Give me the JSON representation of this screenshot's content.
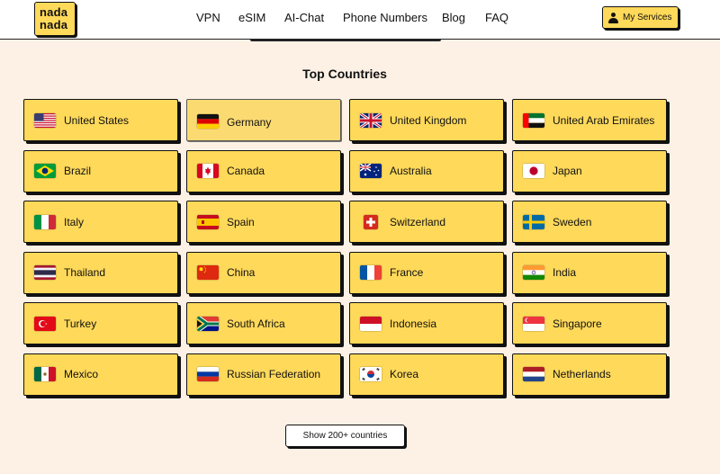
{
  "header": {
    "logo_line1": "nada",
    "logo_line2": "nada",
    "nav": [
      "VPN",
      "eSIM",
      "AI-Chat",
      "Phone Numbers",
      "Blog",
      "FAQ"
    ],
    "my_services": "My Services"
  },
  "section_title": "Top Countries",
  "countries": [
    {
      "name": "United States",
      "flag": "us-flag-icon"
    },
    {
      "name": "Germany",
      "flag": "de-flag-icon"
    },
    {
      "name": "United Kingdom",
      "flag": "gb-flag-icon"
    },
    {
      "name": "United Arab Emirates",
      "flag": "ae-flag-icon"
    },
    {
      "name": "Brazil",
      "flag": "br-flag-icon"
    },
    {
      "name": "Canada",
      "flag": "ca-flag-icon"
    },
    {
      "name": "Australia",
      "flag": "au-flag-icon"
    },
    {
      "name": "Japan",
      "flag": "jp-flag-icon"
    },
    {
      "name": "Italy",
      "flag": "it-flag-icon"
    },
    {
      "name": "Spain",
      "flag": "es-flag-icon"
    },
    {
      "name": "Switzerland",
      "flag": "ch-flag-icon"
    },
    {
      "name": "Sweden",
      "flag": "se-flag-icon"
    },
    {
      "name": "Thailand",
      "flag": "th-flag-icon"
    },
    {
      "name": "China",
      "flag": "cn-flag-icon"
    },
    {
      "name": "France",
      "flag": "fr-flag-icon"
    },
    {
      "name": "India",
      "flag": "in-flag-icon"
    },
    {
      "name": "Turkey",
      "flag": "tr-flag-icon"
    },
    {
      "name": "South Africa",
      "flag": "za-flag-icon"
    },
    {
      "name": "Indonesia",
      "flag": "id-flag-icon"
    },
    {
      "name": "Singapore",
      "flag": "sg-flag-icon"
    },
    {
      "name": "Mexico",
      "flag": "mx-flag-icon"
    },
    {
      "name": "Russian Federation",
      "flag": "ru-flag-icon"
    },
    {
      "name": "Korea",
      "flag": "kr-flag-icon"
    },
    {
      "name": "Netherlands",
      "flag": "nl-flag-icon"
    }
  ],
  "show_more": "Show 200+ countries",
  "colors": {
    "accent": "#ffd95a",
    "background": "#fdf1e6",
    "border": "#111111"
  }
}
